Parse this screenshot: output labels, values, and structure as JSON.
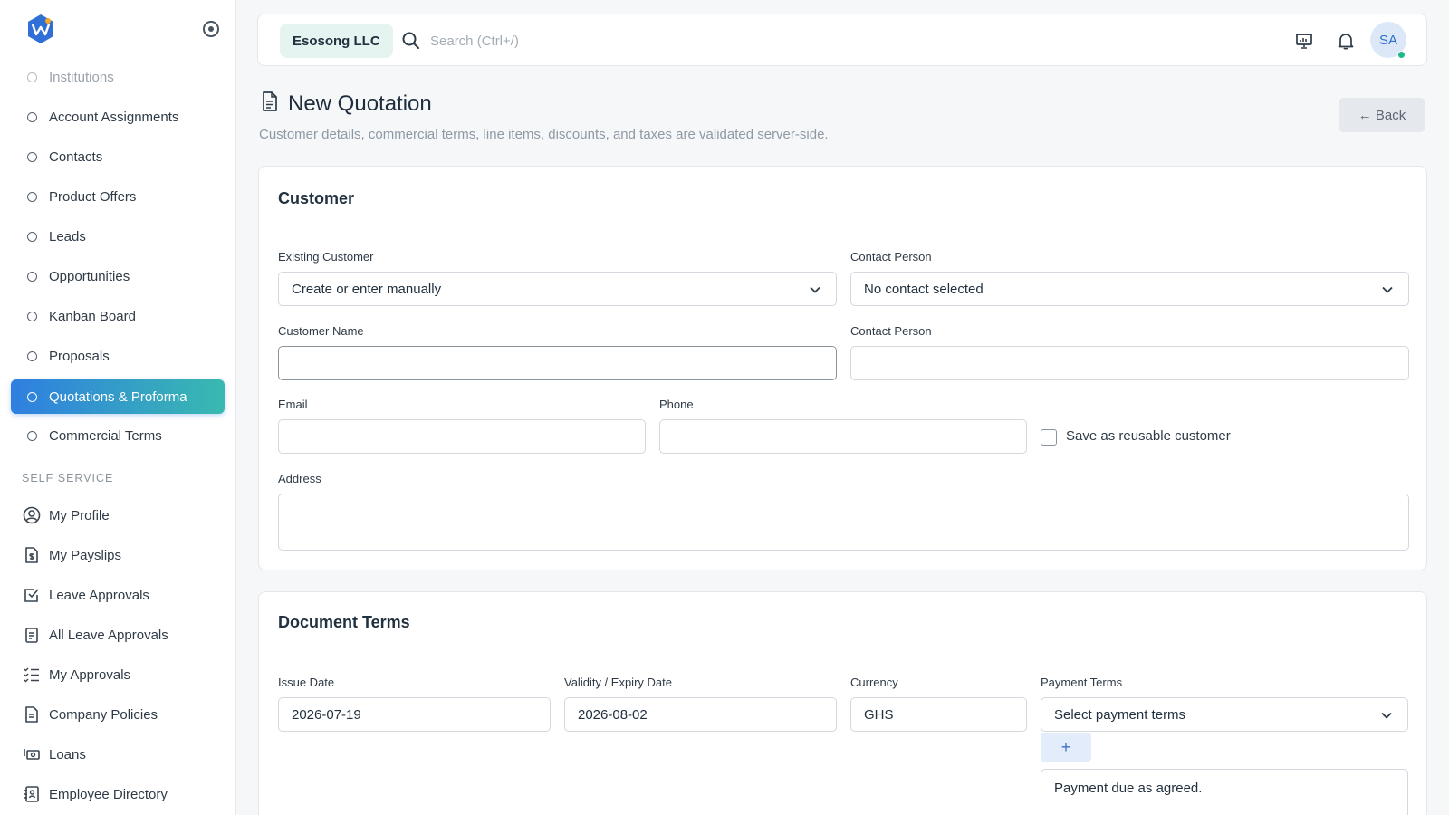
{
  "sidebar": {
    "items": [
      {
        "label": "Institutions"
      },
      {
        "label": "Account Assignments"
      },
      {
        "label": "Contacts"
      },
      {
        "label": "Product Offers"
      },
      {
        "label": "Leads"
      },
      {
        "label": "Opportunities"
      },
      {
        "label": "Kanban Board"
      },
      {
        "label": "Proposals"
      },
      {
        "label": "Quotations & Proforma"
      },
      {
        "label": "Commercial Terms"
      }
    ],
    "self_service_label": "SELF SERVICE",
    "self_service_items": [
      {
        "label": "My Profile",
        "icon": "user-circle-icon"
      },
      {
        "label": "My Payslips",
        "icon": "payslip-icon"
      },
      {
        "label": "Leave Approvals",
        "icon": "checkbox-icon"
      },
      {
        "label": "All Leave Approvals",
        "icon": "clipboard-list-icon"
      },
      {
        "label": "My Approvals",
        "icon": "list-check-icon"
      },
      {
        "label": "Company Policies",
        "icon": "document-icon"
      },
      {
        "label": "Loans",
        "icon": "cash-icon"
      },
      {
        "label": "Employee Directory",
        "icon": "address-book-icon"
      }
    ]
  },
  "topbar": {
    "org_name": "Esosong LLC",
    "search_placeholder": "Search (Ctrl+/)",
    "avatar_initials": "SA"
  },
  "page": {
    "title": "New Quotation",
    "subtitle": "Customer details, commercial terms, line items, discounts, and taxes are validated server-side.",
    "back_label": "← Back"
  },
  "customer": {
    "title": "Customer",
    "existing_customer_label": "Existing Customer",
    "existing_customer_value": "Create or enter manually",
    "contact_person_select_label": "Contact Person",
    "contact_person_select_value": "No contact selected",
    "customer_name_label": "Customer Name",
    "customer_name_value": "",
    "contact_person_label": "Contact Person",
    "contact_person_value": "",
    "email_label": "Email",
    "email_value": "",
    "phone_label": "Phone",
    "phone_value": "",
    "save_reusable_label": "Save as reusable customer",
    "address_label": "Address",
    "address_value": ""
  },
  "terms": {
    "title": "Document Terms",
    "issue_date_label": "Issue Date",
    "issue_date_value": "2026-07-19",
    "validity_label": "Validity / Expiry Date",
    "validity_value": "2026-08-02",
    "currency_label": "Currency",
    "currency_value": "GHS",
    "payment_terms_label": "Payment Terms",
    "payment_terms_value": "Select payment terms",
    "add_label": "+",
    "payment_terms_text": "Payment due as agreed."
  },
  "colors": {
    "accent_start": "#2f7fe0",
    "accent_end": "#39b9b0",
    "status_online": "#1fb88a"
  }
}
